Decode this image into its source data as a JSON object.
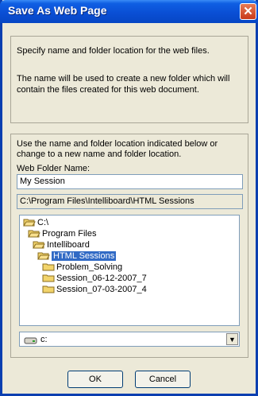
{
  "window": {
    "title": "Save As Web Page",
    "close_symbol": "✕"
  },
  "group1": {
    "line1": "Specify name and folder location for the web files.",
    "line2": "The name will be used to create a new folder which will",
    "line3": "contain the files created for this web document."
  },
  "group2": {
    "instruction1": "Use the name and folder location indicated below or",
    "instruction2": "change to a new name and folder location.",
    "field_label": "Web Folder Name:",
    "field_value": "My Session",
    "path": "C:\\Program Files\\Intelliboard\\HTML Sessions"
  },
  "tree": {
    "items": [
      {
        "label": "C:\\",
        "icon": "open-folder-icon"
      },
      {
        "label": "Program Files",
        "icon": "open-folder-icon"
      },
      {
        "label": "Intelliboard",
        "icon": "open-folder-icon"
      },
      {
        "label": "HTML Sessions",
        "icon": "open-folder-icon",
        "selected": true
      },
      {
        "label": "Problem_Solving",
        "icon": "folder-icon"
      },
      {
        "label": "Session_06-12-2007_7",
        "icon": "folder-icon"
      },
      {
        "label": "Session_07-03-2007_4",
        "icon": "folder-icon"
      }
    ]
  },
  "drive": {
    "value": "c:",
    "icon": "drive-icon"
  },
  "buttons": {
    "ok": "OK",
    "cancel": "Cancel"
  },
  "colors": {
    "selection": "#316ac5",
    "titlebar": "#0a4fd5",
    "window_bg": "#ece9d8"
  }
}
